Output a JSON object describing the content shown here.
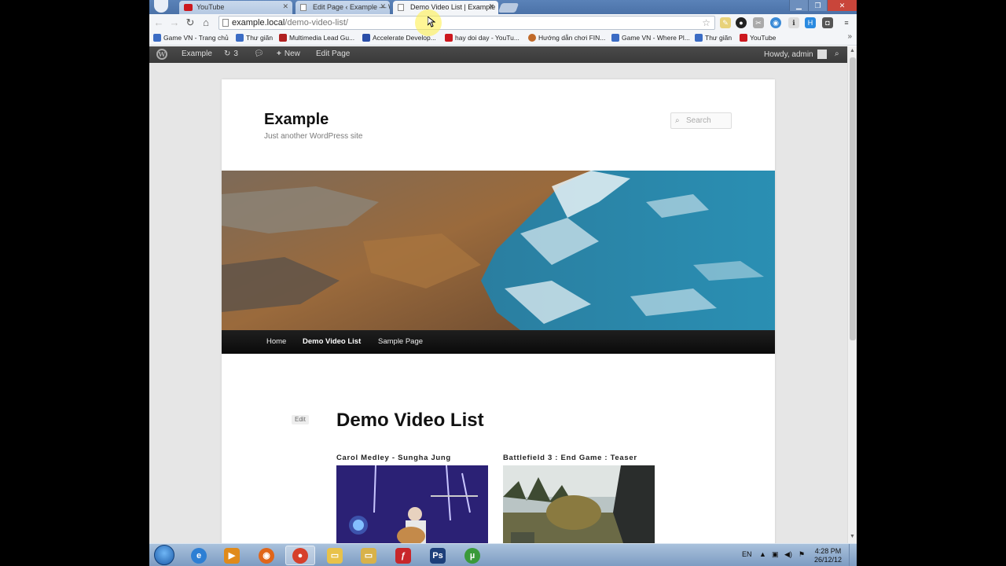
{
  "browser": {
    "tabs": [
      {
        "label": "YouTube",
        "favicon_color": "#cc181e"
      },
      {
        "label": "Edit Page ‹ Example — Wo",
        "favicon_color": "#888888"
      },
      {
        "label": "Demo Video List | Example",
        "favicon_color": "#cccccc"
      }
    ],
    "url_host": "example.local",
    "url_path": "/demo-video-list/",
    "bookmarks": [
      {
        "label": "Game VN - Trang chủ",
        "icon": "people-icon",
        "color": "#3b6cc4"
      },
      {
        "label": "Thư giãn",
        "icon": "people-icon",
        "color": "#3b6cc4"
      },
      {
        "label": "Multimedia Lead Gu...",
        "icon": "lead-icon",
        "color": "#b02020"
      },
      {
        "label": "Accelerate Develop...",
        "icon": "a-icon",
        "color": "#2a4ea8"
      },
      {
        "label": "hay doi day - YouTu...",
        "icon": "youtube-icon",
        "color": "#cc181e"
      },
      {
        "label": "Hướng dẫn chơi FIN...",
        "icon": "game-icon",
        "color": "#c06a2a"
      },
      {
        "label": "Game VN - Where Pl...",
        "icon": "people-icon",
        "color": "#3b6cc4"
      },
      {
        "label": "Thư giãn",
        "icon": "people-icon",
        "color": "#3b6cc4"
      },
      {
        "label": "YouTube",
        "icon": "youtube-icon",
        "color": "#cc181e"
      }
    ]
  },
  "adminbar": {
    "site_name": "Example",
    "updates_count": "3",
    "new_label": "New",
    "edit_label": "Edit Page",
    "howdy": "Howdy, admin"
  },
  "site": {
    "title": "Example",
    "description": "Just another WordPress site",
    "search_placeholder": "Search",
    "menu": [
      {
        "label": "Home",
        "current": false
      },
      {
        "label": "Demo Video List",
        "current": true
      },
      {
        "label": "Sample Page",
        "current": false
      }
    ],
    "edit_link": "Edit",
    "page_title": "Demo Video List",
    "videos": [
      {
        "title": "Carol Medley - Sungha Jung"
      },
      {
        "title": "Battlefield 3 : End Game : Teaser"
      }
    ]
  },
  "taskbar": {
    "lang": "EN",
    "time": "4:28 PM",
    "date": "26/12/12"
  }
}
